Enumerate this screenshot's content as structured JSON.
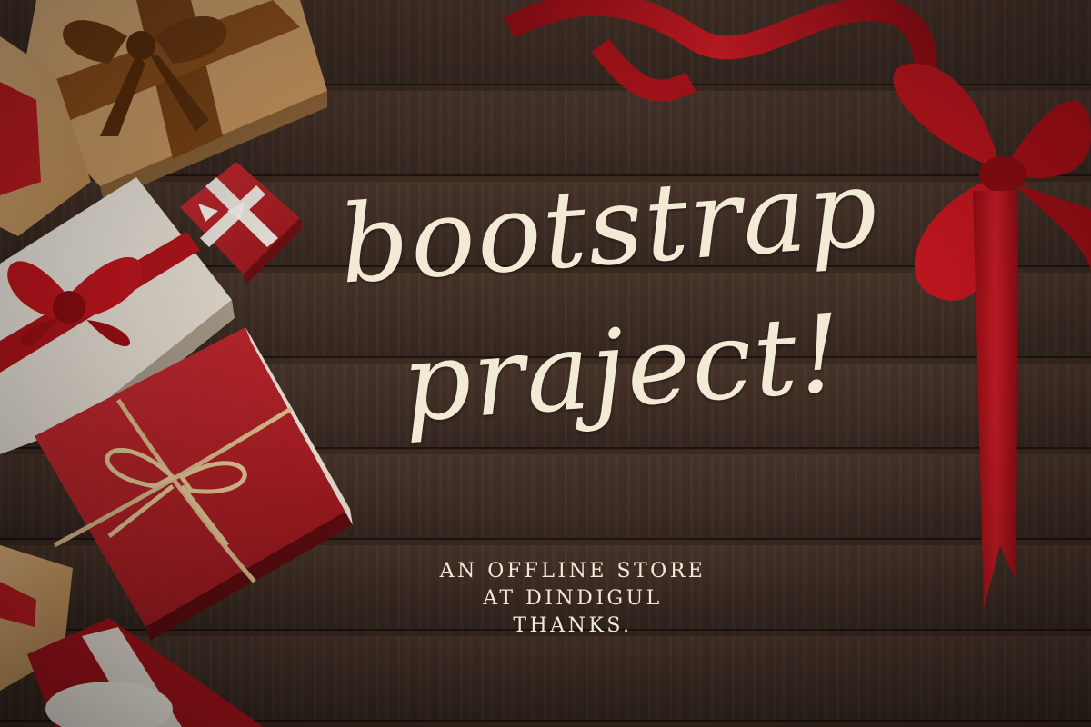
{
  "title": {
    "line1": "bootstrap",
    "line2": "praject!"
  },
  "subtitle": {
    "line1": "AN OFFLINE STORE",
    "line2": "AT DINDIGUL",
    "line3": "THANKS."
  },
  "colors": {
    "background_wood": "#3a2a20",
    "text_cream": "#f3ead6",
    "ribbon_red": "#b5141c",
    "gift_red": "#b8232a",
    "gift_kraft": "#d4a46f",
    "gift_white": "#efe9df",
    "ribbon_brown": "#7a4416"
  },
  "decor": {
    "items": [
      "kraft-gift-box",
      "small-red-gift-box",
      "white-gift-box",
      "red-gift-box-twine",
      "red-ribbon-bow"
    ]
  }
}
